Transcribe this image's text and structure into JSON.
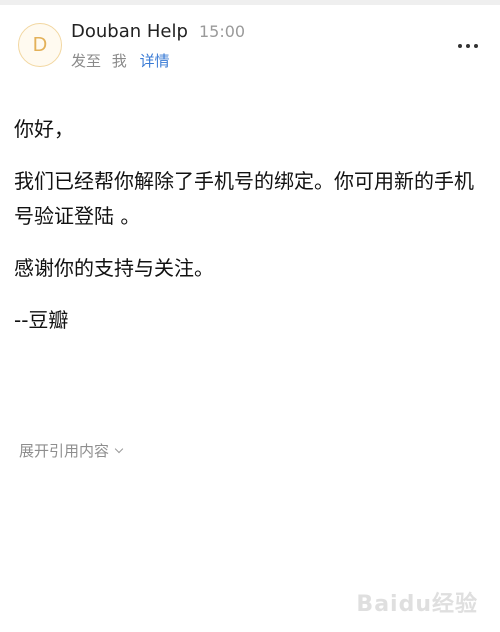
{
  "header": {
    "avatar_letter": "D",
    "sender_name": "Douban Help",
    "time": "15:00",
    "to_label": "发至",
    "to_name": "我",
    "details_label": "详情",
    "more_icon": "more-horizontal-icon"
  },
  "message": {
    "greeting": "你好，",
    "paragraph1": "我们已经帮你解除了手机号的绑定。你可用新的手机号验证登陆 。",
    "paragraph2": "感谢你的支持与关注。",
    "signature": "--豆瓣"
  },
  "quote": {
    "expand_label": "展开引用内容"
  },
  "watermark": {
    "text": "Baidu经验"
  },
  "colors": {
    "link": "#3a7bd5",
    "avatar_border": "#f2d7a1",
    "avatar_text": "#e3b159",
    "muted_text": "#8a8a8a"
  }
}
